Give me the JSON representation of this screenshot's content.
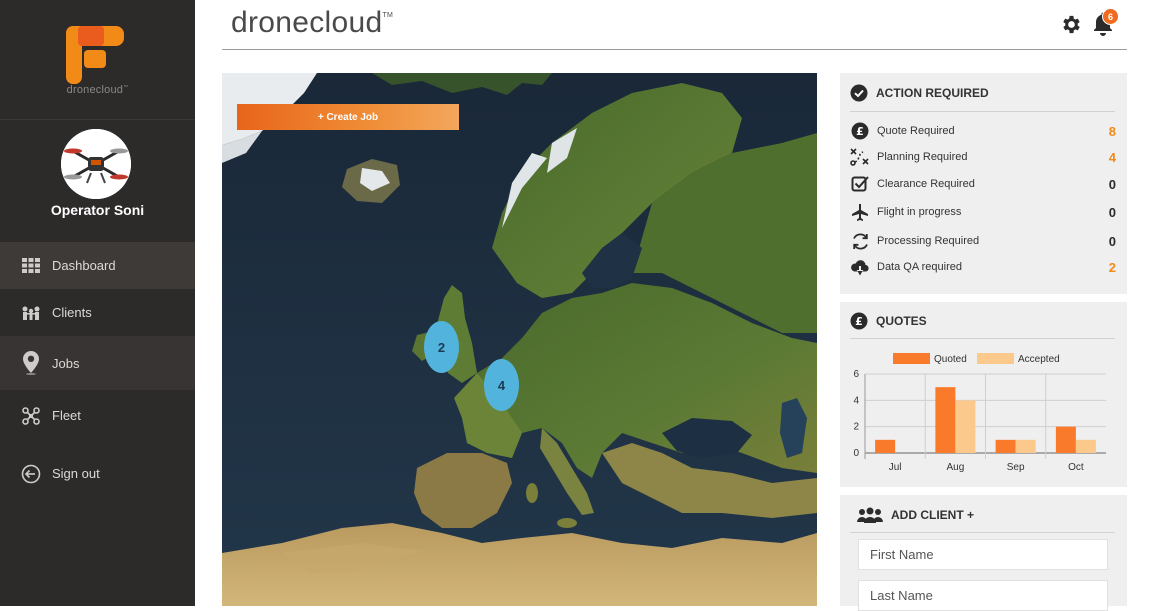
{
  "sidebar": {
    "logo_text": "dronecloud",
    "logo_tm": "™",
    "profile_name": "Operator Soni",
    "nav": [
      {
        "label": "Dashboard",
        "icon": "grid-icon"
      },
      {
        "label": "Clients",
        "icon": "clients-icon"
      },
      {
        "label": "Jobs",
        "icon": "map-pin-icon"
      },
      {
        "label": "Fleet",
        "icon": "drone-icon"
      },
      {
        "label": "Sign out",
        "icon": "sign-out-icon"
      }
    ]
  },
  "header": {
    "brand": "dronecloud",
    "brand_tm": "TM",
    "notification_count": "6"
  },
  "map": {
    "create_job_label": "+ Create Job",
    "clusters": [
      {
        "count": "2"
      },
      {
        "count": "4"
      }
    ]
  },
  "action_required": {
    "title": "ACTION REQUIRED",
    "items": [
      {
        "label": "Quote Required",
        "count": "8",
        "icon": "pound-icon",
        "highlight": true
      },
      {
        "label": "Planning Required",
        "count": "4",
        "icon": "route-icon",
        "highlight": true
      },
      {
        "label": "Clearance Required",
        "count": "0",
        "icon": "check-square-icon",
        "highlight": false
      },
      {
        "label": "Flight in progress",
        "count": "0",
        "icon": "plane-icon",
        "highlight": false
      },
      {
        "label": "Processing Required",
        "count": "0",
        "icon": "refresh-icon",
        "highlight": false
      },
      {
        "label": "Data QA required",
        "count": "2",
        "icon": "cloud-download-icon",
        "highlight": true
      }
    ]
  },
  "quotes": {
    "title": "QUOTES"
  },
  "chart_data": {
    "type": "bar",
    "categories": [
      "Jul",
      "Aug",
      "Sep",
      "Oct"
    ],
    "series": [
      {
        "name": "Quoted",
        "values": [
          1,
          5,
          1,
          2
        ],
        "color": "#f97a2b"
      },
      {
        "name": "Accepted",
        "values": [
          0,
          4,
          1,
          1
        ],
        "color": "#fcc98d"
      }
    ],
    "ylim": [
      0,
      6
    ],
    "yticks": [
      0,
      2,
      4,
      6
    ],
    "legend": "top",
    "grid": true
  },
  "add_client": {
    "title": "ADD CLIENT +",
    "first_name_placeholder": "First Name",
    "last_name_placeholder": "Last Name"
  },
  "colors": {
    "accent": "#f28a17",
    "sidebar": "#2d2b2a",
    "cluster": "#52b4dc"
  }
}
